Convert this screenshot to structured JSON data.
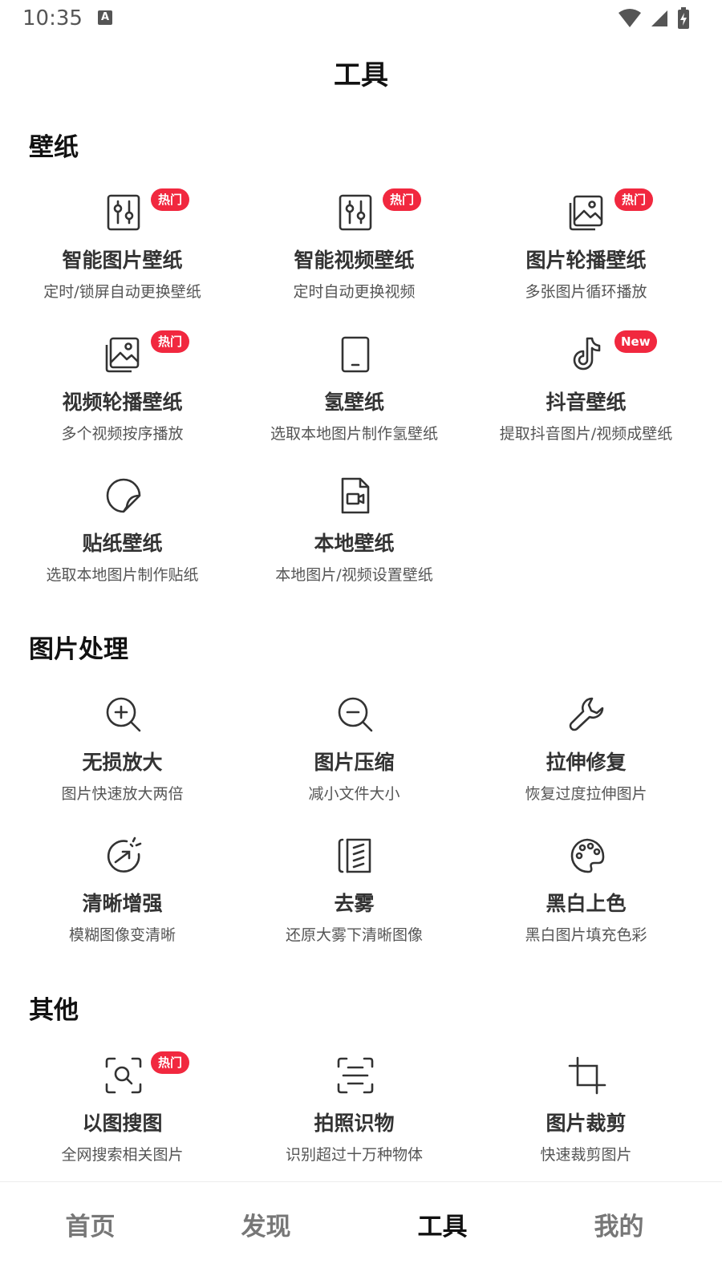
{
  "status_bar": {
    "time": "10:35",
    "notification_label": "A"
  },
  "page_title": "工具",
  "sections": [
    {
      "title": "壁纸",
      "tools": [
        {
          "name": "智能图片壁纸",
          "desc": "定时/锁屏自动更换壁纸",
          "badge": "热门",
          "icon": "sliders-icon"
        },
        {
          "name": "智能视频壁纸",
          "desc": "定时自动更换视频",
          "badge": "热门",
          "icon": "sliders-icon"
        },
        {
          "name": "图片轮播壁纸",
          "desc": "多张图片循环播放",
          "badge": "热门",
          "icon": "image-gallery-icon"
        },
        {
          "name": "视频轮播壁纸",
          "desc": "多个视频按序播放",
          "badge": "热门",
          "icon": "image-gallery-icon"
        },
        {
          "name": "氢壁纸",
          "desc": "选取本地图片制作氢壁纸",
          "badge": "",
          "icon": "phone-icon"
        },
        {
          "name": "抖音壁纸",
          "desc": "提取抖音图片/视频成壁纸",
          "badge": "New",
          "icon": "tiktok-icon"
        },
        {
          "name": "贴纸壁纸",
          "desc": "选取本地图片制作贴纸",
          "badge": "",
          "icon": "sticker-icon"
        },
        {
          "name": "本地壁纸",
          "desc": "本地图片/视频设置壁纸",
          "badge": "",
          "icon": "video-file-icon"
        }
      ]
    },
    {
      "title": "图片处理",
      "tools": [
        {
          "name": "无损放大",
          "desc": "图片快速放大两倍",
          "badge": "",
          "icon": "zoom-in-icon"
        },
        {
          "name": "图片压缩",
          "desc": "减小文件大小",
          "badge": "",
          "icon": "zoom-out-icon"
        },
        {
          "name": "拉伸修复",
          "desc": "恢复过度拉伸图片",
          "badge": "",
          "icon": "wrench-icon"
        },
        {
          "name": "清晰增强",
          "desc": "模糊图像变清晰",
          "badge": "",
          "icon": "enhance-icon"
        },
        {
          "name": "去雾",
          "desc": "还原大雾下清晰图像",
          "badge": "",
          "icon": "dehaze-icon"
        },
        {
          "name": "黑白上色",
          "desc": "黑白图片填充色彩",
          "badge": "",
          "icon": "palette-icon"
        }
      ]
    },
    {
      "title": "其他",
      "tools": [
        {
          "name": "以图搜图",
          "desc": "全网搜索相关图片",
          "badge": "热门",
          "icon": "image-search-icon"
        },
        {
          "name": "拍照识物",
          "desc": "识别超过十万种物体",
          "badge": "",
          "icon": "scan-icon"
        },
        {
          "name": "图片裁剪",
          "desc": "快速裁剪图片",
          "badge": "",
          "icon": "crop-icon"
        }
      ]
    }
  ],
  "bottom_nav": [
    {
      "label": "首页",
      "active": false
    },
    {
      "label": "发现",
      "active": false
    },
    {
      "label": "工具",
      "active": true
    },
    {
      "label": "我的",
      "active": false
    }
  ],
  "colors": {
    "badge": "#f1283f",
    "text_primary": "#111111",
    "text_secondary": "#555555"
  }
}
